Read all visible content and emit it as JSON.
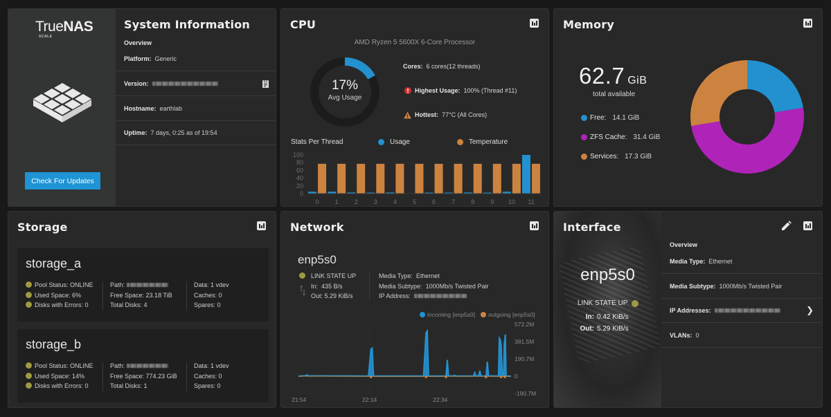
{
  "system": {
    "logo": {
      "part1": "True",
      "part2": "NAS",
      "edition": "SCALE"
    },
    "title": "System Information",
    "overview_label": "Overview",
    "platform_label": "Platform:",
    "platform": "Generic",
    "version_label": "Version:",
    "version": "[redacted]",
    "hostname_label": "Hostname:",
    "hostname": "earthlab",
    "uptime_label": "Uptime:",
    "uptime": "7 days, 0:25 as of 19:54",
    "update_button": "Check For Updates",
    "icons": {
      "copy": "clipboard-icon",
      "emblem": "truenas-emblem-icon"
    }
  },
  "cpu": {
    "title": "CPU",
    "model": "AMD Ryzen 5 5600X 6-Core Processor",
    "avg_usage": "17%",
    "avg_usage_value": 17,
    "avg_usage_label": "Avg Usage",
    "cores_label": "Cores:",
    "cores": "6 cores(12 threads)",
    "highest_label": "Highest Usage:",
    "highest": "100%  (Thread #11)",
    "hottest_label": "Hottest:",
    "hottest": "77°C  (All Cores)",
    "threads_title": "Stats Per Thread",
    "legend_usage": "Usage",
    "legend_temp": "Temperature",
    "colors": {
      "usage": "#2391cf",
      "temperature": "#cd8340",
      "error": "#d32f2f",
      "warning": "#cd8340"
    }
  },
  "memory": {
    "title": "Memory",
    "total": "62.7",
    "total_unit": "GiB",
    "total_label": "total available",
    "items": [
      {
        "label": "Free:",
        "value": "14.1 GiB",
        "gib": 14.1,
        "color": "#2391cf"
      },
      {
        "label": "ZFS Cache:",
        "value": "31.4 GiB",
        "gib": 31.4,
        "color": "#b023b8"
      },
      {
        "label": "Services:",
        "value": "17.3 GiB",
        "gib": 17.3,
        "color": "#cd8340"
      }
    ]
  },
  "storage": {
    "title": "Storage",
    "pools": [
      {
        "name": "storage_a",
        "status_label": "Pool Status:",
        "status": "ONLINE",
        "used_label": "Used Space:",
        "used": "6%",
        "errors_label": "Disks with Errors:",
        "errors": "0",
        "path_label": "Path:",
        "path": "[redacted]",
        "free_label": "Free Space:",
        "free": "23.18 TiB",
        "disks_label": "Total Disks:",
        "disks": "4",
        "data_label": "Data:",
        "data": "1 vdev",
        "caches_label": "Caches:",
        "caches": "0",
        "spares_label": "Spares:",
        "spares": "0"
      },
      {
        "name": "storage_b",
        "status_label": "Pool Status:",
        "status": "ONLINE",
        "used_label": "Used Space:",
        "used": "14%",
        "errors_label": "Disks with Errors:",
        "errors": "0",
        "path_label": "Path:",
        "path": "[redacted]",
        "free_label": "Free Space:",
        "free": "774.23 GiB",
        "disks_label": "Total Disks:",
        "disks": "1",
        "data_label": "Data:",
        "data": "1 vdev",
        "caches_label": "Caches:",
        "caches": "0",
        "spares_label": "Spares:",
        "spares": "0"
      }
    ]
  },
  "network": {
    "title": "Network",
    "interface": "enp5s0",
    "link_state": "LINK STATE UP",
    "in_label": "In:",
    "in": "435 B/s",
    "out_label": "Out:",
    "out": "5.29 KiB/s",
    "media_type_label": "Media Type:",
    "media_type": "Ethernet",
    "media_subtype_label": "Media Subtype:",
    "media_subtype": "1000Mb/s Twisted Pair",
    "ip_label": "IP Address:",
    "ip": "[redacted]",
    "legend_in": "incoming [enp5s0]",
    "legend_out": "outgoing [enp5s0]"
  },
  "interface": {
    "title": "Interface",
    "name": "enp5s0",
    "link_state": "LINK STATE UP",
    "in_label": "In:",
    "in": "0.42 KiB/s",
    "out_label": "Out:",
    "out": "5.29 KiB/s",
    "overview_label": "Overview",
    "media_type_label": "Media Type:",
    "media_type": "Ethernet",
    "media_subtype_label": "Media Subtype:",
    "media_subtype": "1000Mb/s Twisted Pair",
    "ip_label": "IP Addresses:",
    "ip": "[redacted]",
    "vlans_label": "VLANs:",
    "vlans": "0"
  },
  "chart_data": [
    {
      "type": "bar",
      "title": "Stats Per Thread",
      "categories": [
        "0",
        "1",
        "2",
        "3",
        "4",
        "5",
        "6",
        "7",
        "8",
        "9",
        "10",
        "11"
      ],
      "series": [
        {
          "name": "Usage",
          "color": "#2391cf",
          "values": [
            5,
            5,
            3,
            2,
            3,
            0,
            2,
            2,
            3,
            2,
            5,
            100
          ]
        },
        {
          "name": "Temperature",
          "color": "#cd8340",
          "values": [
            77,
            77,
            77,
            77,
            77,
            77,
            77,
            77,
            77,
            77,
            77,
            77
          ]
        }
      ],
      "yticks": [
        0,
        20,
        40,
        60,
        80,
        100
      ],
      "ylim": [
        0,
        100
      ],
      "legend": "top"
    },
    {
      "type": "line",
      "title": "",
      "series": [
        {
          "name": "incoming [enp5s0]",
          "color": "#2391cf",
          "points": [
            [
              0,
              0
            ],
            [
              3,
              5
            ],
            [
              3.5,
              15
            ],
            [
              4,
              3
            ],
            [
              10,
              4
            ],
            [
              16,
              3
            ],
            [
              28,
              2
            ],
            [
              29,
              300
            ],
            [
              29.5,
              310
            ],
            [
              30,
              2
            ],
            [
              50,
              2
            ],
            [
              51,
              480
            ],
            [
              51.5,
              500
            ],
            [
              52,
              2
            ],
            [
              59,
              2
            ],
            [
              59.5,
              180
            ],
            [
              60,
              3
            ],
            [
              62,
              3
            ],
            [
              62.5,
              10
            ],
            [
              63,
              2
            ],
            [
              70,
              2
            ],
            [
              70.5,
              40
            ],
            [
              71,
              3
            ],
            [
              72,
              3
            ],
            [
              72.5,
              60
            ],
            [
              73,
              2
            ],
            [
              75,
              2
            ],
            [
              75.5,
              160
            ],
            [
              76,
              3
            ],
            [
              80,
              3
            ],
            [
              80.3,
              420
            ],
            [
              80.7,
              400
            ],
            [
              81,
              350
            ],
            [
              81.5,
              2
            ],
            [
              82,
              2
            ],
            [
              82.3,
              360
            ],
            [
              82.7,
              460
            ],
            [
              83,
              2
            ],
            [
              85,
              0
            ]
          ]
        },
        {
          "name": "outgoing [enp5s0]",
          "color": "#cd8340",
          "points": [
            [
              0,
              0
            ],
            [
              29,
              -3
            ],
            [
              51,
              -3
            ],
            [
              59,
              -2
            ],
            [
              75,
              -2
            ],
            [
              81,
              -4
            ],
            [
              82.5,
              -4
            ],
            [
              85,
              0
            ]
          ]
        }
      ],
      "xlabel_ticks": [
        "21:54",
        "22:14",
        "22:34"
      ],
      "yticks": [
        "572.2M",
        "381.5M",
        "190.7M",
        "0",
        "-190.7M"
      ],
      "ylim": [
        -190.7,
        572.2
      ],
      "xlim_minutes": [
        0,
        60
      ],
      "legend": "top-right"
    }
  ]
}
